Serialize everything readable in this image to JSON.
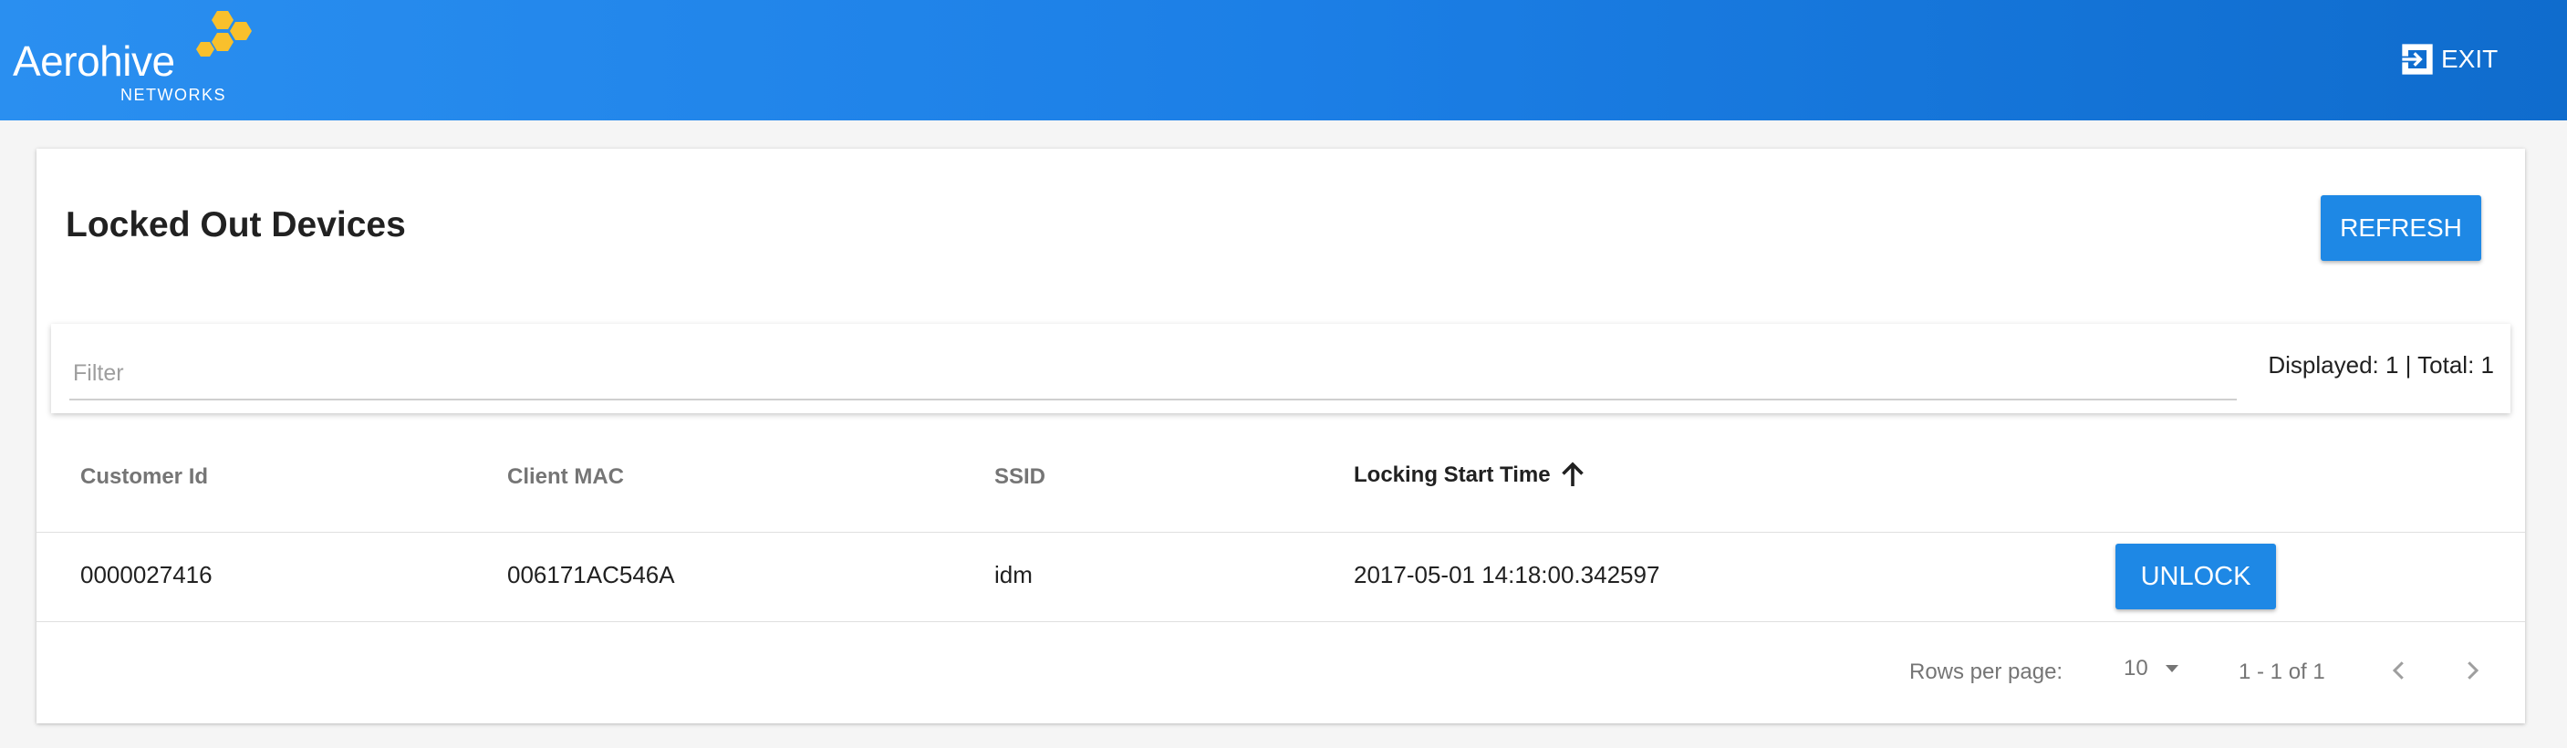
{
  "header": {
    "logo_word": "Aerohive",
    "logo_sub": "NETWORKS",
    "exit_label": "EXIT"
  },
  "colors": {
    "primary": "#1e88e5",
    "header_gradient_start": "#2a8ff0",
    "header_gradient_end": "#0f6ccd",
    "logo_hex": "#f9c02c"
  },
  "page": {
    "title": "Locked Out Devices",
    "refresh_label": "REFRESH"
  },
  "filter": {
    "placeholder": "Filter",
    "value": "",
    "counts": "Displayed: 1 | Total: 1"
  },
  "table": {
    "columns": [
      {
        "label": "Customer Id"
      },
      {
        "label": "Client MAC"
      },
      {
        "label": "SSID"
      },
      {
        "label": "Locking Start Time",
        "sorted": "ascending"
      }
    ],
    "rows": [
      {
        "customer_id": "0000027416",
        "client_mac": "006171AC546A",
        "ssid": "idm",
        "locking_start_time": "2017-05-01 14:18:00.342597",
        "action_label": "UNLOCK"
      }
    ]
  },
  "pagination": {
    "rows_per_page_label": "Rows per page:",
    "rows_per_page_value": "10",
    "range": "1 - 1 of 1"
  },
  "icons": {
    "exit": "exit-icon",
    "sort": "arrow-up-icon",
    "dropdown": "triangle-down-icon",
    "prev": "chevron-left-icon",
    "next": "chevron-right-icon",
    "logo": "hexagon-cluster-icon"
  }
}
